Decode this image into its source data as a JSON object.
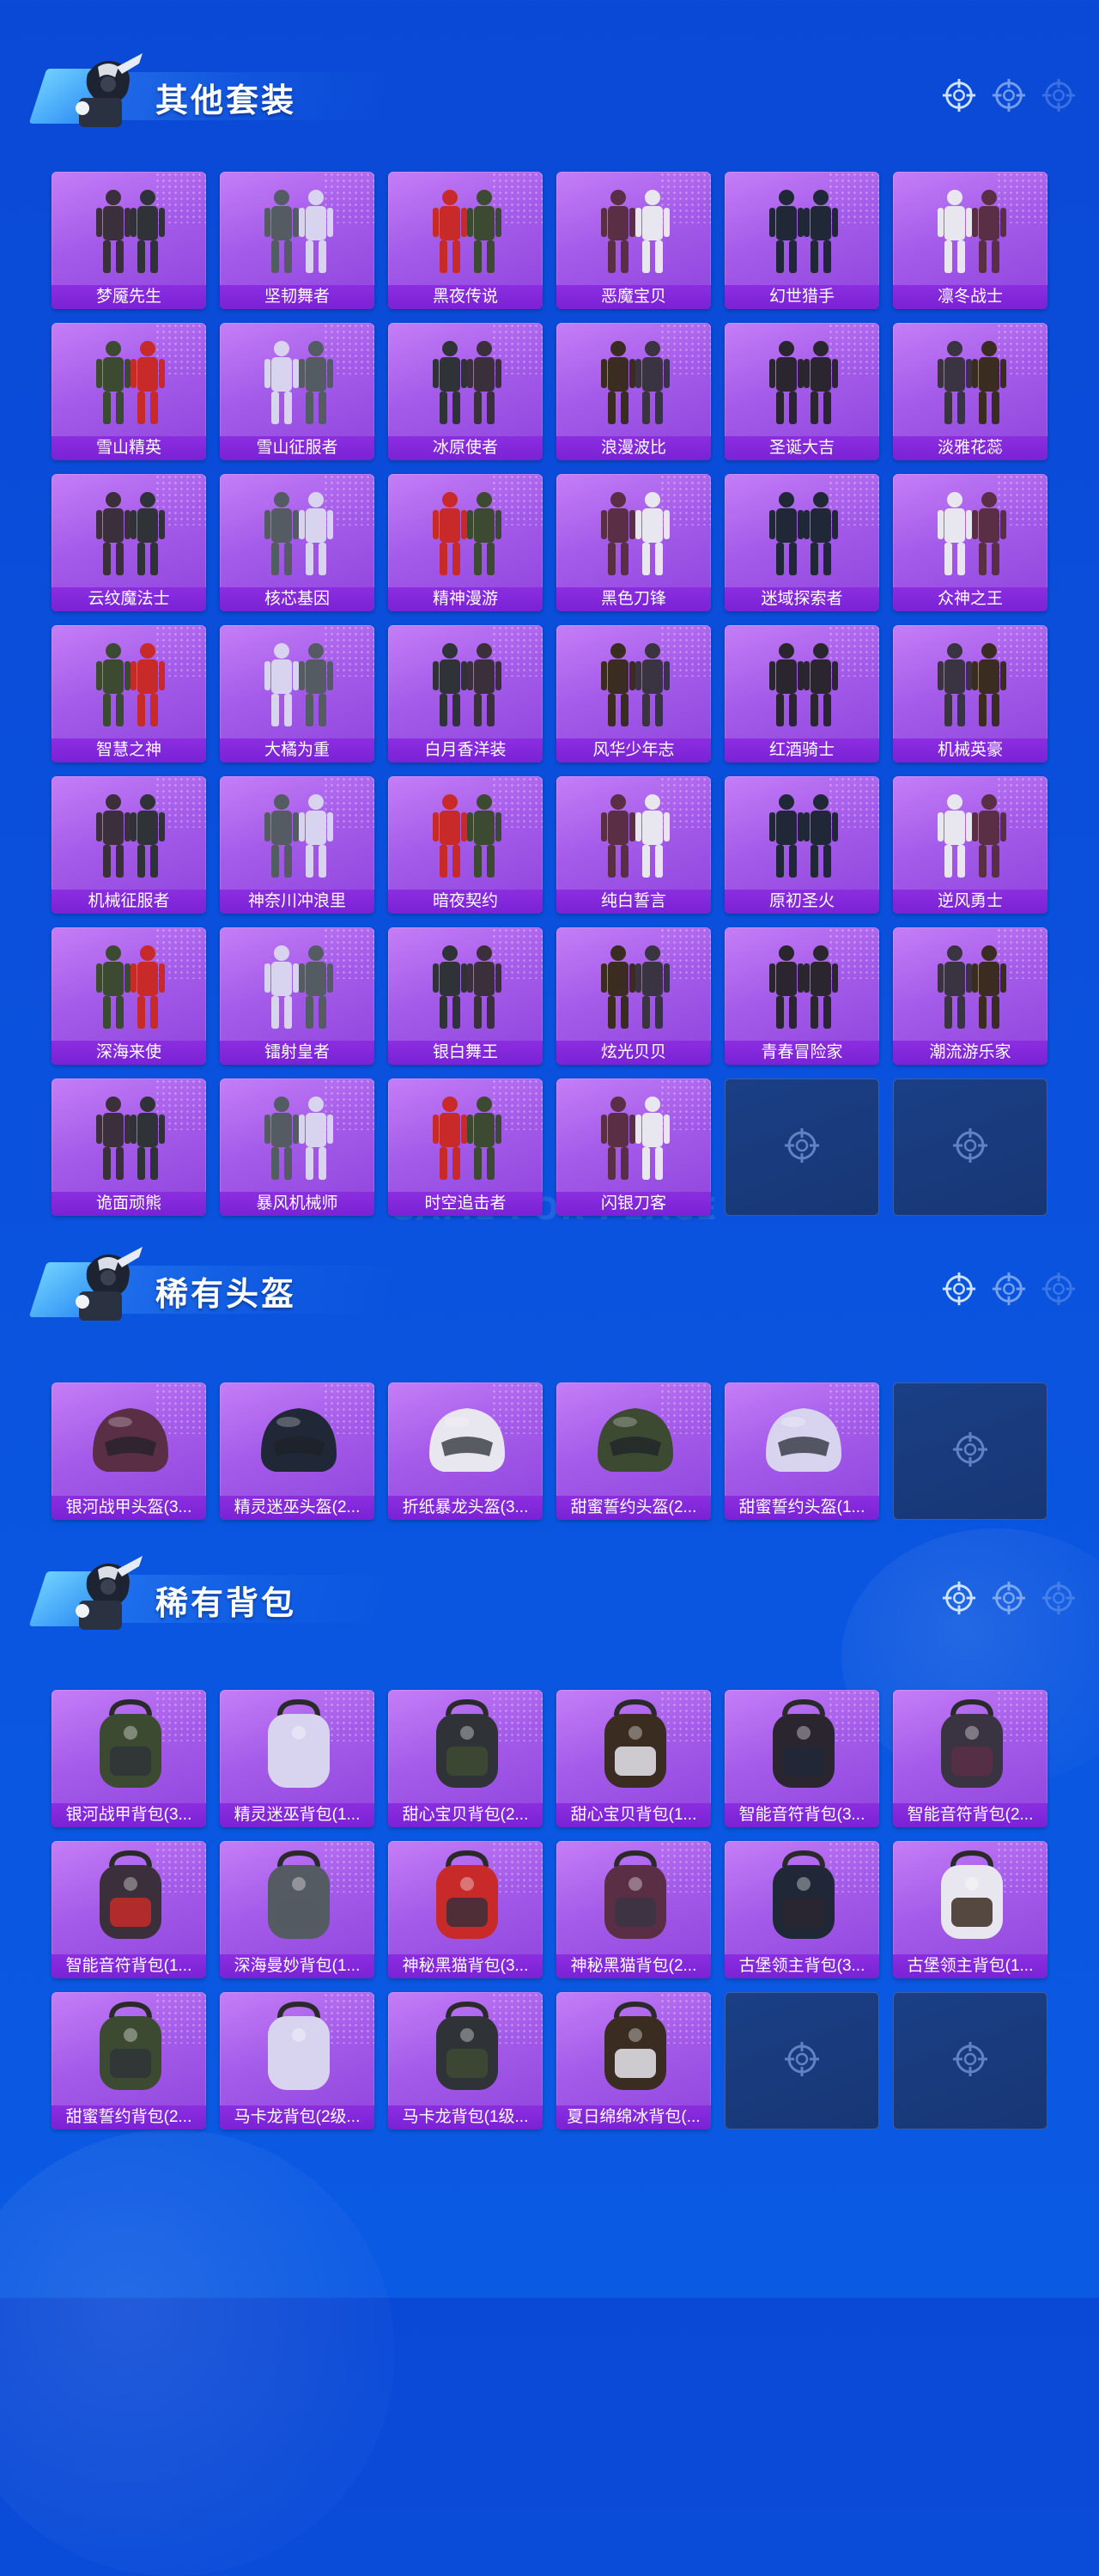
{
  "sections": [
    {
      "title": "其他套装",
      "items": [
        "梦魇先生",
        "坚韧舞者",
        "黑夜传说",
        "恶魔宝贝",
        "幻世猎手",
        "凛冬战士",
        "雪山精英",
        "雪山征服者",
        "冰原使者",
        "浪漫波比",
        "圣诞大吉",
        "淡雅花蕊",
        "云纹魔法士",
        "核芯基因",
        "精神漫游",
        "黑色刀锋",
        "迷域探索者",
        "众神之王",
        "智慧之神",
        "大橘为重",
        "白月香洋装",
        "风华少年志",
        "红酒骑士",
        "机械英豪",
        "机械征服者",
        "神奈川冲浪里",
        "暗夜契约",
        "纯白誓言",
        "原初圣火",
        "逆风勇士",
        "深海来使",
        "镭射皇者",
        "银白舞王",
        "炫光贝贝",
        "青春冒险家",
        "潮流游乐家",
        "诡面顽熊",
        "暴风机械师",
        "时空追击者",
        "闪银刀客"
      ],
      "empty_slots": 2
    },
    {
      "title": "稀有头盔",
      "items": [
        "银河战甲头盔(3...",
        "精灵迷巫头盔(2...",
        "折纸暴龙头盔(3...",
        "甜蜜誓约头盔(2...",
        "甜蜜誓约头盔(1..."
      ],
      "empty_slots": 1
    },
    {
      "title": "稀有背包",
      "items": [
        "银河战甲背包(3...",
        "精灵迷巫背包(1...",
        "甜心宝贝背包(2...",
        "甜心宝贝背包(1...",
        "智能音符背包(3...",
        "智能音符背包(2...",
        "智能音符背包(1...",
        "深海曼妙背包(1...",
        "神秘黑猫背包(3...",
        "神秘黑猫背包(2...",
        "古堡领主背包(3...",
        "古堡领主背包(1...",
        "甜蜜誓约背包(2...",
        "马卡龙背包(2级...",
        "马卡龙背包(1级...",
        "夏日绵绵冰背包(..."
      ],
      "empty_slots": 2
    }
  ],
  "watermark": "GAME FOR PEACE",
  "icons": {
    "header_mascot": "soldier-mascot-icon",
    "header_marker": "crosshair-icon",
    "empty_slot": "crosshair-icon"
  },
  "colors": {
    "background": "#0a4fdb",
    "card": "#a45be9",
    "card_label": "#7a22d6",
    "empty_card": "#1b3f86"
  }
}
